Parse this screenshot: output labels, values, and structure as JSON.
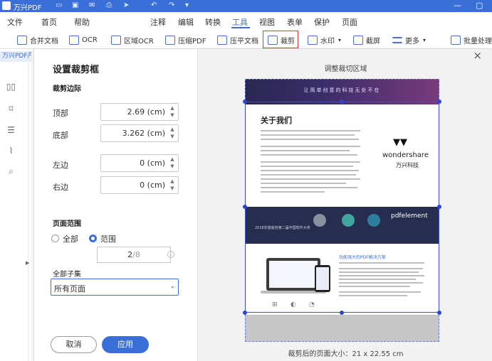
{
  "titlebar": {
    "app_name": "万兴PDF",
    "window_buttons": [
      "—",
      "▢"
    ]
  },
  "menu": [
    "文件",
    "首页",
    "帮助",
    "注释",
    "编辑",
    "转换",
    "工具",
    "视图",
    "表单",
    "保护",
    "页面"
  ],
  "menu_active": "工具",
  "toolbar": [
    {
      "label": "合并文档",
      "icon": "merge-icon"
    },
    {
      "label": "OCR",
      "icon": "ocr-icon"
    },
    {
      "label": "区域OCR",
      "icon": "area-ocr-icon"
    },
    {
      "label": "压缩PDF",
      "icon": "compress-icon"
    },
    {
      "label": "压平文档",
      "icon": "flatten-icon"
    },
    {
      "label": "裁剪",
      "icon": "crop-icon"
    },
    {
      "label": "水印",
      "icon": "watermark-icon"
    },
    {
      "label": "截屏",
      "icon": "screenshot-icon"
    },
    {
      "label": "更多",
      "icon": "more-icon"
    },
    {
      "label": "批量处理",
      "icon": "batch-icon"
    }
  ],
  "sidebar": {
    "tab": "万兴PDF产",
    "icons": [
      "thumbnail-icon",
      "bookmark-icon",
      "comment-icon",
      "attachment-icon",
      "search-icon"
    ]
  },
  "dialog": {
    "title": "设置裁剪框",
    "margins_title": "裁剪边际",
    "top_label": "顶部",
    "top_value": "2.69 (cm)",
    "bottom_label": "底部",
    "bottom_value": "3.262 (cm)",
    "left_label": "左边",
    "left_value": "0 (cm)",
    "right_label": "右边",
    "right_value": "0 (cm)",
    "page_range_title": "页面范围",
    "radio_all": "全部",
    "radio_range": "范围",
    "page_value": "2",
    "page_total": "/8",
    "subset_label": "全部子集",
    "subset_value": "所有页面",
    "cancel": "取消",
    "apply": "应用",
    "preview_title": "调整裁切区域",
    "result_size": "裁剪后的页面大小：21 x 22.55 cm"
  },
  "preview": {
    "banner": "让简单创意的科技无处不在",
    "heading": "关于我们",
    "brand": "wondershare",
    "brand_cn": "万兴科技",
    "band_left": "2018年度最佳第二届中国软件大奖",
    "band_product": "pdfelement",
    "feature_title": "功能强大的PDF解决方案"
  }
}
